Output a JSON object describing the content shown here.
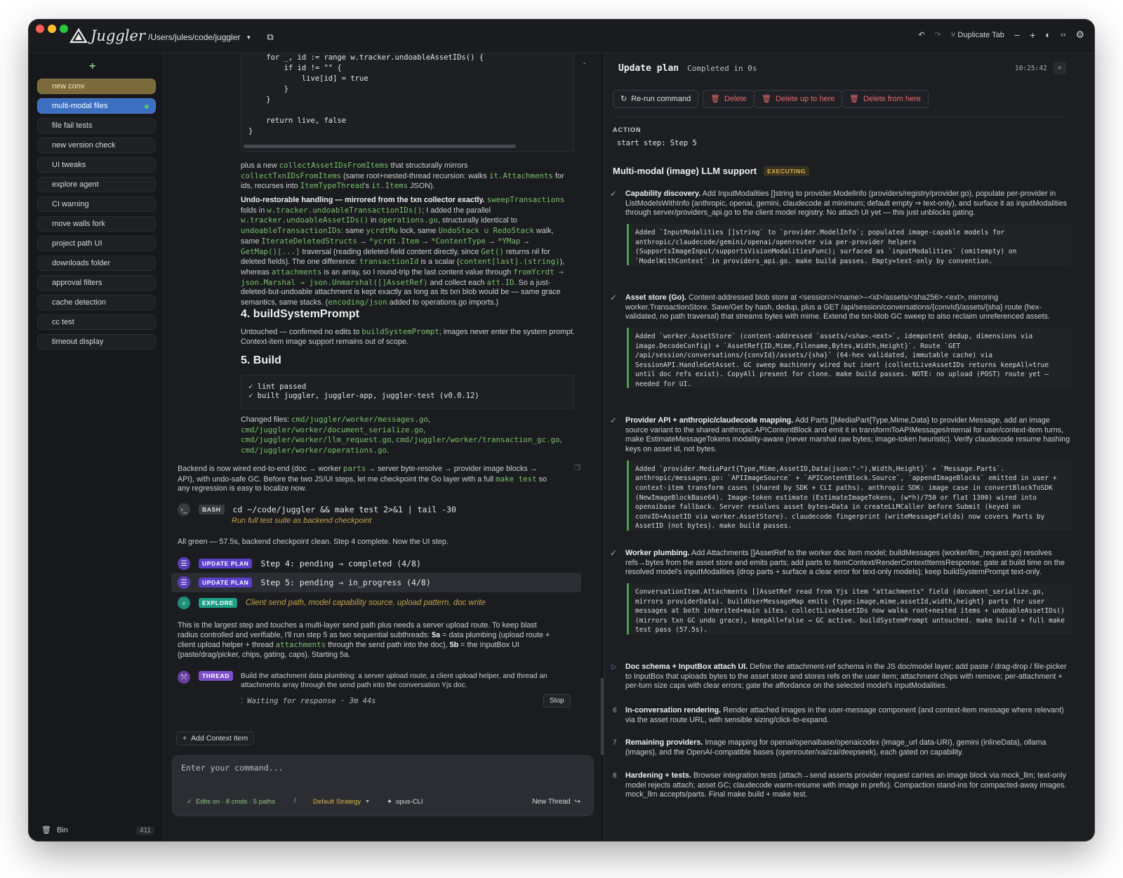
{
  "app": {
    "name": "Juggler",
    "path": "/Users/jules/code/juggler"
  },
  "toolbar": {
    "duplicate_tab": "Duplicate Tab"
  },
  "sidebar": {
    "items": [
      "new conv",
      "multi-modal files",
      "file fail tests",
      "new version check",
      "UI tweaks",
      "explore agent",
      "CI warning",
      "move walls fork",
      "project path UI",
      "downloads folder",
      "approval filters",
      "cache detection",
      "cc test",
      "timeout display"
    ],
    "bin_label": "Bin",
    "bin_count": "411"
  },
  "center": {
    "code_top": "    for _, id := range w.tracker.undoableAssetIDs() {\n        if id != \"\" {\n            live[id] = true\n        }\n    }\n\n    return live, false\n}",
    "p1a": "plus a new ",
    "p1b": "collectAssetIDsFromItems",
    "p1c": " that structurally mirrors",
    "p1d": "collectTxnIDsFromItems",
    "p1e": " (same root+nested-thread recursion: walks ",
    "p1f": "it.Attachments",
    "p1g": " for",
    "p1h": "ids, recurses into ",
    "p1i": "ItemTypeThread",
    "p1j": "'s ",
    "p1k": "it.Items",
    "p1l": " JSON).",
    "undo_title": "Undo-restorable handling — mirrored from the txn collector exactly.",
    "undo_l1": "sweepTransactions",
    "undo_l2a": "folds in ",
    "undo_l2b": "w.tracker.undoableTransactionIDs()",
    "undo_l2c": "; I added the parallel",
    "undo_l3a": "w.tracker.undoableAssetIDs()",
    "undo_l3b": " in ",
    "undo_l3c": "operations.go",
    "undo_l3d": ", structurally identical to",
    "undo_l4a": "undoableTransactionIDs",
    "undo_l4b": ": same ",
    "undo_l4c": "ycrdtMu",
    "undo_l4d": " lock, same ",
    "undo_l4e": "UndoStack ∪ RedoStack",
    "undo_l4f": " walk,",
    "undo_l5a": "same ",
    "undo_l5b": "IterateDeletedStructs",
    "undo_l5c": " → ",
    "undo_l5d": "*ycrdt.Item",
    "undo_l5e": " → ",
    "undo_l5f": "*ContentType",
    "undo_l5g": " → ",
    "undo_l5h": "*YMap",
    "undo_l5i": " →",
    "undo_l6a": "GetMap()[...]",
    "undo_l6b": " traversal (reading deleted-field content directly, since ",
    "undo_l6c": "Get()",
    "undo_l6d": " returns nil for",
    "undo_l7a": "deleted fields). The one difference: ",
    "undo_l7b": "transactionId",
    "undo_l7c": " is a scalar (",
    "undo_l7d": "content[last].(string)",
    "undo_l7e": "),",
    "undo_l8a": "whereas ",
    "undo_l8b": "attachments",
    "undo_l8c": " is an array, so I round-trip the last content value through ",
    "undo_l8d": "fromYcrdt →",
    "undo_l9a": "json.Marshal → json.Unmarshal([]AssetRef)",
    "undo_l9b": " and collect each ",
    "undo_l9c": "att.ID",
    "undo_l9d": ". So a just-",
    "undo_l10": "deleted-but-undoable attachment is kept exactly as long as its txn blob would be — same grace",
    "undo_l11a": "semantics, same stacks. (",
    "undo_l11b": "encoding/json",
    "undo_l11c": " added to operations.go imports.)",
    "h4": "4. buildSystemPrompt",
    "h4_t1a": "Untouched — confirmed no edits to ",
    "h4_t1b": "buildSystemPrompt",
    "h4_t1c": "; images never enter the system prompt.",
    "h4_t2": "Context-item image support remains out of scope.",
    "h5": "5. Build",
    "build_code": "✓ lint passed\n✓ built juggler, juggler-app, juggler-test (v0.0.12)",
    "changed_label": "Changed files: ",
    "changed1": "cmd/juggler/worker/messages.go",
    "changed2": "cmd/juggler/worker/document_serialize.go",
    "changed3": "cmd/juggler/worker/llm_request.go",
    "changed4": "cmd/juggler/worker/transaction_gc.go",
    "changed5": "cmd/juggler/worker/operations.go",
    "backend_a": "Backend is now wired end-to-end (doc → worker ",
    "backend_b": "parts",
    "backend_c": " → server byte-resolve → provider image blocks →",
    "backend_d": "API), with undo-safe GC. Before the two JS/UI steps, let me checkpoint the Go layer with a full ",
    "backend_e": "make test",
    "backend_f": " so",
    "backend_g": "any regression is easy to localize now.",
    "bash_badge": "BASH",
    "bash_cmd": "cd ~/code/juggler && make test 2>&1 | tail -30",
    "bash_desc": "Run full test suite as backend checkpoint",
    "green_line": "All green — 57.5s, backend checkpoint clean. Step 4 complete. Now the UI step.",
    "up_badge": "UPDATE PLAN",
    "up1": "Step 4: pending → completed (4/8)",
    "up2": "Step 5: pending → in_progress (4/8)",
    "explore_badge": "EXPLORE",
    "explore_text": "Client send path, model capability source, upload pattern, doc write",
    "large_a": "This is the largest step and touches a multi-layer send path plus needs a server upload route. To keep blast",
    "large_b": "radius controlled and verifiable, I'll run step 5 as two sequential subthreads: ",
    "large_c": "5a",
    "large_d": " = data plumbing (upload route +",
    "large_e": "client upload helper + thread ",
    "large_f": "attachments",
    "large_g": " through the send path into the doc), ",
    "large_h": "5b",
    "large_i": " = the InputBox UI",
    "large_j": "(paste/drag/picker, chips, gating, caps). Starting 5a.",
    "thread_badge": "THREAD",
    "thread_text": "Build the attachment data plumbing: a server upload route, a client upload helper, and thread an attachments array through the send path into the conversation Yjs doc.",
    "waiting": "Waiting for response · 3m 44s",
    "stop": "Stop",
    "add_context": "Add Context Item",
    "input_placeholder": "Enter your command...",
    "edits": "Edits on · 8 cmds · 5 paths",
    "strategy": "Default Strategy",
    "model": "opus-CLI",
    "new_thread": "New Thread"
  },
  "panel": {
    "title": "Update plan",
    "status": "Completed in 0s",
    "time": "10:25:42",
    "btn_rerun": "Re-run command",
    "btn_delete": "Delete",
    "btn_delete_up": "Delete up to here",
    "btn_delete_from": "Delete from here",
    "action_label": "ACTION",
    "action_value": "start step: Step 5",
    "plan_title": "Multi-modal (image) LLM support",
    "plan_badge": "EXECUTING",
    "s1_title": "Capability discovery.",
    "s1_text": "Add InputModalities []string to provider.ModelInfo (providers/registry/provider.go), populate per-provider in ListModelsWithInfo (anthropic, openai, gemini, claudecode at minimum; default empty ⇒ text-only), and surface it as inputModalities through server/providers_api.go to the client model registry. No attach UI yet — this just unblocks gating.",
    "s1_quote": "Added `InputModalities []string` to `provider.ModelInfo`; populated image-capable models for anthropic/claudecode/gemini/openai/openrouter via per-provider helpers (SupportsImageInput/supportsVisionModalitiesFunc); surfaced as `inputModalities` (omitempty) on `ModelWithContext` in providers_api.go. make build passes. Empty=text-only by convention.",
    "s2_title": "Asset store (Go).",
    "s2_text": "Content-addressed blob store at <session>/<name>--<id>/assets/<sha256>.<ext>, mirroring worker.TransactionStore. Save/Get by hash, dedup, plus a GET /api/session/conversations/{convId}/assets/{sha} route (hex-validated, no path traversal) that streams bytes with mime. Extend the txn-blob GC sweep to also reclaim unreferenced assets.",
    "s2_quote": "Added `worker.AssetStore` (content-addressed `assets/<sha>.<ext>`, idempotent dedup, dimensions via image.DecodeConfig) + `AssetRef{ID,Mime,Filename,Bytes,Width,Height}`. Route `GET /api/session/conversations/{convId}/assets/{sha}` (64-hex validated, immutable cache) via SessionAPI.HandleGetAsset. GC sweep machinery wired but inert (collectLiveAssetIDs returns keepAll=true until doc refs exist). CopyAll present for clone. make build passes. NOTE: no upload (POST) route yet — needed for UI.",
    "s3_title": "Provider API + anthropic/claudecode mapping.",
    "s3_text": "Add Parts []MediaPart{Type,Mime,Data} to provider.Message, add an image source variant to the shared anthropic.APIContentBlock and emit it in transformToAPIMessagesInternal for user/context-item turns, make EstimateMessageTokens modality-aware (never marshal raw bytes; image-token heuristic). Verify claudecode resume hashing keys on asset id, not bytes.",
    "s3_quote": "Added `provider.MediaPart{Type,Mime,AssetID,Data(json:\"-\"),Width,Height}` + `Message.Parts`. anthropic/messages.go: `APIImageSource` + `APIContentBlock.Source`, `appendImageBlocks` emitted in user + context-item transform cases (shared by SDK + CLI paths). anthropic SDK: image case in convertBlockToSDK (NewImageBlockBase64). Image-token estimate (EstimateImageTokens, (w*h)/750 or flat 1300) wired into openaibase fallback. Server resolves asset bytes→Data in createLLMCaller before Submit (keyed on convID+AssetID via worker.AssetStore). claudecode fingerprint (writeMessageFields) now covers Parts by AssetID (not bytes). make build passes.",
    "s4_title": "Worker plumbing.",
    "s4_text": "Add Attachments []AssetRef to the worker doc item model; buildMessages (worker/llm_request.go) resolves refs→bytes from the asset store and emits parts; add parts to ItemContext/RenderContextItemsResponse; gate at build time on the resolved model's inputModalities (drop parts + surface a clear error for text-only models); keep buildSystemPrompt text-only.",
    "s4_quote": "ConversationItem.Attachments []AssetRef read from Yjs item \"attachments\" field (document_serialize.go, mirrors providerData). buildUserMessageMap emits {type:image,mime,assetId,width,height} parts for user messages at both inherited+main sites. collectLiveAssetIDs now walks root+nested items + undoableAssetIDs() (mirrors txn GC undo grace), keepAll=false → GC active. buildSystemPrompt untouched. make build + full make test pass (57.5s).",
    "s5_title": "Doc schema + InputBox attach UI.",
    "s5_text": "Define the attachment-ref schema in the JS doc/model layer; add paste / drag-drop / file-picker to InputBox that uploads bytes to the asset store and stores refs on the user item; attachment chips with remove; per-attachment + per-turn size caps with clear errors; gate the affordance on the selected model's inputModalities.",
    "s6_num": "6",
    "s6_title": "In-conversation rendering.",
    "s6_text": "Render attached images in the user-message component (and context-item message where relevant) via the asset route URL, with sensible sizing/click-to-expand.",
    "s7_num": "7",
    "s7_title": "Remaining providers.",
    "s7_text": "Image mapping for openai/openaibase/openaicodex (image_url data-URI), gemini (inlineData), ollama (images), and the OpenAI-compatible bases (openrouter/xai/zai/deepseek), each gated on capability.",
    "s8_num": "8",
    "s8_title": "Hardening + tests.",
    "s8_text": "Browser integration tests (attach→send asserts provider request carries an image block via mock_llm; text-only model rejects attach; asset GC; claudecode warm-resume with image in prefix). Compaction stand-ins for compacted-away images. mock_llm accepts/parts. Final make build + make test."
  },
  "colors": {
    "accent": "#3d6fc1",
    "green": "#79c06b",
    "danger": "#e05a5a",
    "purple": "#7b5cd6",
    "teal": "#1f9e86"
  }
}
